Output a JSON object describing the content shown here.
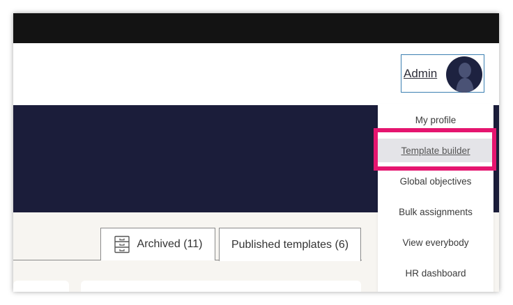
{
  "header": {
    "user": {
      "name": "Admin"
    }
  },
  "user_menu": {
    "items": [
      {
        "label": "My profile"
      },
      {
        "label": "Template builder"
      },
      {
        "label": "Global objectives"
      },
      {
        "label": "Bulk assignments"
      },
      {
        "label": "View everybody"
      },
      {
        "label": "HR dashboard"
      }
    ],
    "active_index": 1
  },
  "tabs": [
    {
      "label": "Archived (11)",
      "icon": "archive-icon"
    },
    {
      "label": "Published templates (6)"
    }
  ],
  "colors": {
    "topbar": "#131313",
    "banner": "#1b1d3a",
    "highlight": "#e5156f",
    "focus_outline": "#3b7fb1"
  }
}
